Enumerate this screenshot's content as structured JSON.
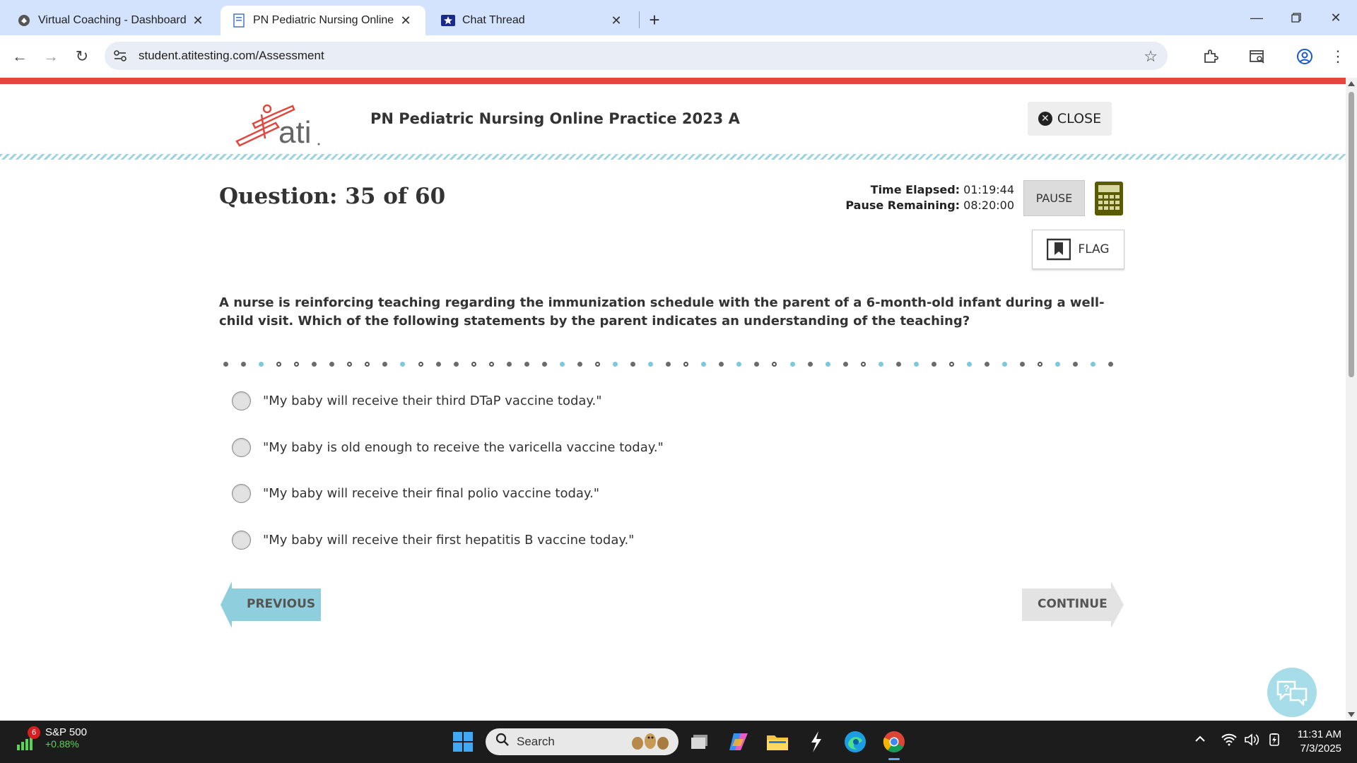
{
  "browser": {
    "tabs": [
      {
        "title": "Virtual Coaching - Dashboard",
        "icon": "coaching-favicon"
      },
      {
        "title": "PN Pediatric Nursing Online Pra",
        "icon": "document-favicon"
      },
      {
        "title": "Chat Thread",
        "icon": "star-favicon"
      }
    ],
    "url": "student.atitesting.com/Assessment"
  },
  "header": {
    "logo_text": "ati",
    "exam_title": "PN Pediatric Nursing Online Practice 2023 A",
    "close_label": "CLOSE"
  },
  "question": {
    "number_label": "Question: 35 of 60",
    "time_elapsed_label": "Time Elapsed:",
    "time_elapsed": "01:19:44",
    "pause_remaining_label": "Pause Remaining:",
    "pause_remaining": "08:20:00",
    "pause_label": "PAUSE",
    "flag_label": "FLAG",
    "stem": "A nurse is reinforcing teaching regarding the immunization schedule with the parent of a 6-month-old infant during a well-child visit. Which of the following statements by the parent indicates an understanding of the teaching?",
    "progress_dots": [
      "dark",
      "dark",
      "blue",
      "ring",
      "ring",
      "dark",
      "dark",
      "ring",
      "ring",
      "dark",
      "blue",
      "ring",
      "dark",
      "dark",
      "ring",
      "ring",
      "dark",
      "dark",
      "dark",
      "blue",
      "dark",
      "ring",
      "blue",
      "dark",
      "blue",
      "dark",
      "ring",
      "blue",
      "dark",
      "blue",
      "dark",
      "ring",
      "blue",
      "dark",
      "blue",
      "dark",
      "ring",
      "blue",
      "dark",
      "blue",
      "dark",
      "ring",
      "blue",
      "dark",
      "blue",
      "dark",
      "ring",
      "blue",
      "dark",
      "blue",
      "dark"
    ],
    "options": [
      "\"My baby will receive their third DTaP vaccine today.\"",
      "\"My baby is old enough to receive the varicella vaccine today.\"",
      "\"My baby will receive their final polio vaccine today.\"",
      "\"My baby will receive their first hepatitis B vaccine today.\""
    ],
    "previous_label": "PREVIOUS",
    "continue_label": "CONTINUE"
  },
  "taskbar": {
    "stock_badge": "6",
    "stock_name": "S&P 500",
    "stock_change": "+0.88%",
    "search_placeholder": "Search",
    "time": "11:31 AM",
    "date": "7/3/2025"
  },
  "colors": {
    "accent_red": "#e2473e",
    "accent_teal": "#8fcfdd",
    "calculator_green": "#5a5a00"
  }
}
